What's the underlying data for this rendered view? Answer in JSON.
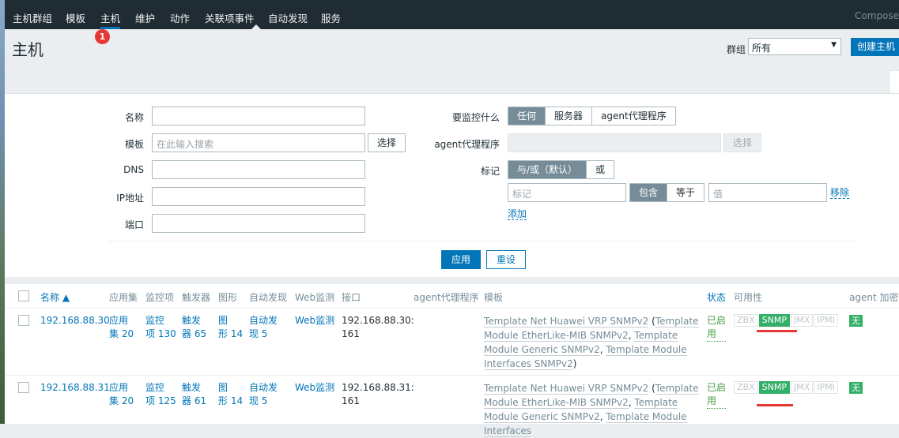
{
  "nav": {
    "items": [
      "主机群组",
      "模板",
      "主机",
      "维护",
      "动作",
      "关联项事件",
      "自动发现",
      "服务"
    ],
    "active": "主机",
    "right_text": "Compose",
    "badge": "1"
  },
  "header": {
    "title": "主机",
    "group_label": "群组",
    "group_value": "所有",
    "create_button": "创建主机"
  },
  "filter": {
    "name_label": "名称",
    "template_label": "模板",
    "template_placeholder": "在此输入搜索",
    "select_button": "选择",
    "dns_label": "DNS",
    "ip_label": "IP地址",
    "port_label": "端口",
    "monitor_label": "要监控什么",
    "monitor_options": [
      "任何",
      "服务器",
      "agent代理程序"
    ],
    "proxy_label": "agent代理程序",
    "proxy_select_button": "选择",
    "tags_label": "标记",
    "tag_mode_options": [
      "与/或（默认）",
      "或"
    ],
    "tag_placeholder": "标记",
    "tag_operator_options": [
      "包含",
      "等于"
    ],
    "value_placeholder": "值",
    "remove_link": "移除",
    "add_link": "添加",
    "apply_button": "应用",
    "reset_button": "重设"
  },
  "table": {
    "headers": {
      "name": "名称 ▲",
      "apps": "应用集",
      "items": "监控项",
      "triggers": "触发器",
      "graphs": "图形",
      "discovery": "自动发现",
      "web": "Web监测",
      "interface": "接口",
      "proxy": "agent代理程序",
      "templates": "模板",
      "status": "状态",
      "availability": "可用性",
      "encryption": "agent 加密"
    },
    "rows": [
      {
        "name": "192.168.88.30",
        "apps": [
          "应用",
          "集 20"
        ],
        "items": [
          "监控",
          "项 130"
        ],
        "triggers": [
          "触发",
          "器 65"
        ],
        "graphs": [
          "图",
          "形 14"
        ],
        "discovery": [
          "自动发",
          "现 5"
        ],
        "web": "Web监测",
        "interface": [
          "192.168.88.30:",
          "161"
        ],
        "template_main": "Template Net Huawei VRP SNMPv2",
        "template_subs": [
          "Template Module EtherLike-MIB SNMPv2",
          "Template Module Generic SNMPv2",
          "Template Module Interfaces SNMPv2"
        ],
        "status": [
          "已启",
          "用"
        ],
        "availability": [
          "ZBX",
          "SNMP",
          "JMX",
          "IPMI"
        ],
        "encryption": "无"
      },
      {
        "name": "192.168.88.31",
        "apps": [
          "应用",
          "集 20"
        ],
        "items": [
          "监控",
          "项 125"
        ],
        "triggers": [
          "触发",
          "器 61"
        ],
        "graphs": [
          "图",
          "形 14"
        ],
        "discovery": [
          "自动发",
          "现 5"
        ],
        "web": "Web监测",
        "interface": [
          "192.168.88.31:",
          "161"
        ],
        "template_main": "Template Net Huawei VRP SNMPv2",
        "template_subs": [
          "Template Module EtherLike-MIB SNMPv2",
          "Template Module Generic SNMPv2",
          "Template Module Interfaces"
        ],
        "status": [
          "已启",
          "用"
        ],
        "availability": [
          "ZBX",
          "SNMP",
          "JMX",
          "IPMI"
        ],
        "encryption": "无"
      }
    ]
  },
  "colors": {
    "nav_bg": "#1f2c33",
    "accent": "#0275b8",
    "available_green": "#34af67",
    "annotation_red": "#e53935"
  }
}
